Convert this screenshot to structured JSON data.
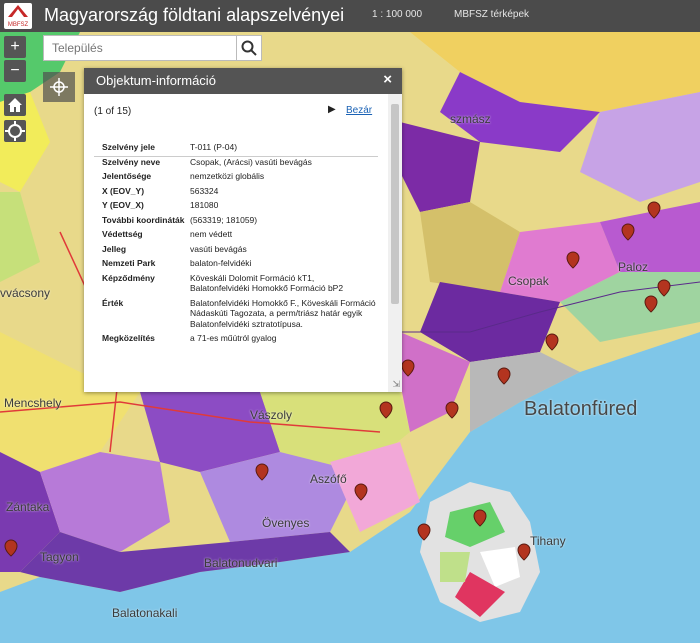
{
  "header": {
    "title": "Magyarország földtani alapszelvényei",
    "scale": "1 : 100 000",
    "link": "MBFSZ térképek",
    "logo_text": "MBFSZ"
  },
  "search": {
    "placeholder": "Település"
  },
  "controls": {
    "zoom_in": "+",
    "zoom_out": "−"
  },
  "popup": {
    "title": "Objektum-információ",
    "close_symbol": "×",
    "page_count": "(1 of 15)",
    "next_symbol": "▶",
    "close_link": "Bezár",
    "rows": [
      {
        "key": "Szelvény jele",
        "value": "T-011 (P-04)"
      },
      {
        "key": "Szelvény neve",
        "value": "Csopak, (Arácsi) vasúti bevágás"
      },
      {
        "key": "Jelentősége",
        "value": "nemzetközi globális"
      },
      {
        "key": "X (EOV_Y)",
        "value": "563324"
      },
      {
        "key": "Y (EOV_X)",
        "value": "181080"
      },
      {
        "key": "További koordináták",
        "value": "(563319; 181059)"
      },
      {
        "key": "Védettség",
        "value": "nem védett"
      },
      {
        "key": "Jelleg",
        "value": "vasúti bevágás"
      },
      {
        "key": "Nemzeti Park",
        "value": "balaton-felvidéki"
      },
      {
        "key": "Képződmény",
        "value": "Köveskáli Dolomit Formáció kT1, Balatonfelvidéki Homokkő Formáció bP2"
      },
      {
        "key": "Érték",
        "value": "Balatonfelvidéki Homokkő F., Köveskáli Formáció Nádaskúti Tagozata, a perm/triász határ egyik Balatonfelvidéki sztratotípusa."
      },
      {
        "key": "Megközelítés",
        "value": "a 71-es műútról gyalog"
      }
    ]
  },
  "map": {
    "places": {
      "balatonfured": "Balatonfüred",
      "tihany": "Tihany",
      "aszofo": "Aszófő",
      "ovenyes": "Övenyes",
      "vaszoly": "Vászoly",
      "mencshely": "Mencshely",
      "csopak": "Csopak",
      "paloznak": "Paloz",
      "balatonudvari": "Balatonudvari",
      "balatonakali": "Balatonakali",
      "tagyon": "Tagyon",
      "zanka": "Zántaka",
      "veszprem_edge": "vvácsony",
      "lovas": "szmász"
    },
    "colors": {
      "water": "#7fc6e8",
      "pin": "#b3341f"
    }
  }
}
